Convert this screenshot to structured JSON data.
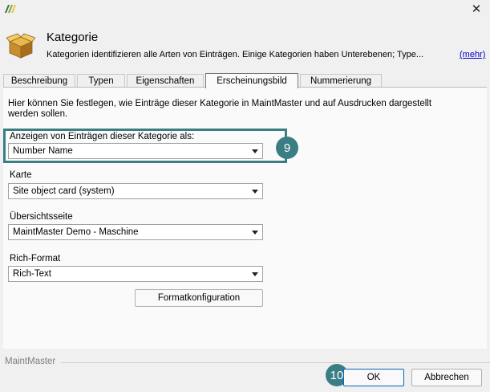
{
  "window": {
    "close_glyph": "✕",
    "logo_icon": "maintmaster-logo-icon"
  },
  "header": {
    "title": "Kategorie",
    "description": "Kategorien identifizieren alle Arten von Einträgen. Einige Kategorien haben Unterebenen; Type...",
    "more_link": "(mehr)",
    "icon": "package-box-icon"
  },
  "tabs": [
    {
      "label": "Beschreibung",
      "active": false
    },
    {
      "label": "Typen",
      "active": false
    },
    {
      "label": "Eigenschaften",
      "active": false
    },
    {
      "label": "Erscheinungsbild",
      "active": true
    },
    {
      "label": "Nummerierung",
      "active": false
    }
  ],
  "content": {
    "intro": "Hier können Sie festlegen, wie Einträge dieser Kategorie in MaintMaster und auf Ausdrucken dargestellt werden sollen.",
    "fields": [
      {
        "label": "Anzeigen von Einträgen dieser Kategorie als:",
        "value": "Number Name"
      },
      {
        "label": "Karte",
        "value": "Site object card (system)"
      },
      {
        "label": "Übersichtsseite",
        "value": "MaintMaster Demo - Maschine"
      },
      {
        "label": "Rich-Format",
        "value": "Rich-Text"
      }
    ],
    "format_button": "Formatkonfiguration"
  },
  "annotations": {
    "badge_select": "9",
    "badge_ok": "10",
    "highlight_color": "#3a7e84"
  },
  "footer": {
    "brand": "MaintMaster",
    "ok_label": "OK",
    "cancel_label": "Abbrechen"
  }
}
